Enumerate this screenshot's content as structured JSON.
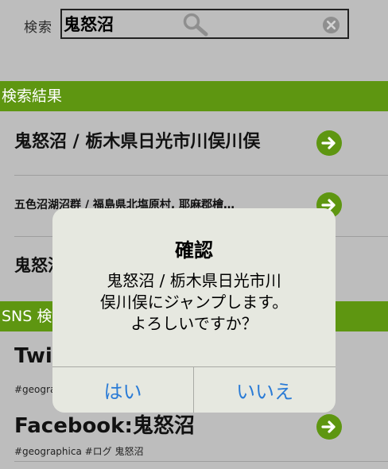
{
  "search": {
    "label": "検索",
    "value": "鬼怒沼"
  },
  "sections": {
    "results_header": "検索結果",
    "sns_header": "SNS 検"
  },
  "results": [
    {
      "title": "鬼怒沼 / 栃木県日光市川俣川俣"
    },
    {
      "title": "五色沼湖沼群 / 福島県北塩原村, 耶麻郡檜…"
    },
    {
      "title": "鬼怒沼"
    }
  ],
  "sns": [
    {
      "title": "Twit",
      "tags": "#geograp"
    },
    {
      "title": "Facebook:鬼怒沼",
      "tags": "#geographica #ログ 鬼怒沼"
    }
  ],
  "dialog": {
    "title": "確認",
    "message_line1": "鬼怒沼 / 栃木県日光市川",
    "message_line2": "俣川俣にジャンプします。",
    "message_line3": "よろしいですか？",
    "yes_label": "はい",
    "no_label": "いいえ"
  },
  "colors": {
    "section_green": "#5e9611",
    "arrow_green": "#5e9611",
    "dialog_button_blue": "#2a7bd6",
    "dimmed_background": "#bdbdbd"
  }
}
